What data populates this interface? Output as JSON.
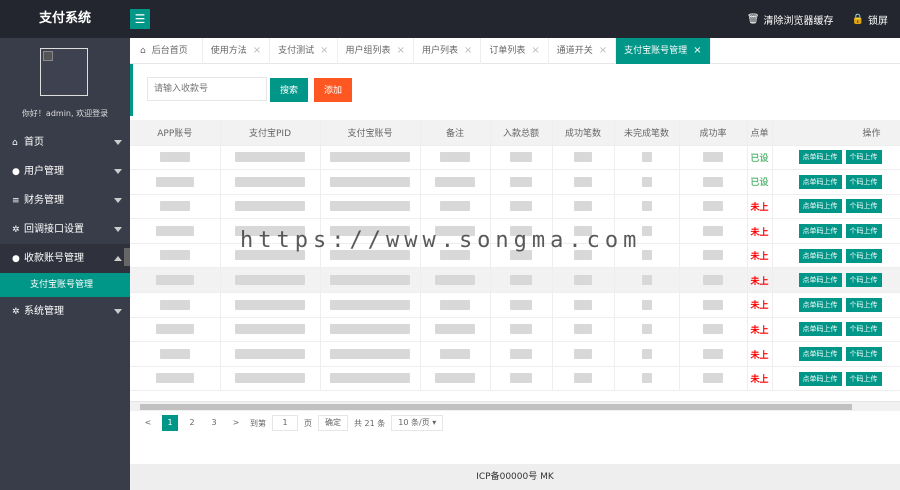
{
  "app": {
    "title": "支付系统"
  },
  "header": {
    "menu_icon": "hamburger-icon",
    "clear_cache": "清除浏览器缓存",
    "lock_screen": "锁屏"
  },
  "sidebar": {
    "greeting": "你好！admin, 欢迎登录",
    "items": [
      {
        "label": "首页",
        "icon": "home-icon"
      },
      {
        "label": "用户管理",
        "icon": "user-icon"
      },
      {
        "label": "财务管理",
        "icon": "list-icon"
      },
      {
        "label": "回调接口设置",
        "icon": "gear-icon"
      },
      {
        "label": "收款账号管理",
        "icon": "users-icon"
      },
      {
        "label": "系统管理",
        "icon": "gear-icon"
      }
    ],
    "active_sub": "支付宝账号管理"
  },
  "tabs": [
    {
      "label": "后台首页"
    },
    {
      "label": "使用方法"
    },
    {
      "label": "支付测试"
    },
    {
      "label": "用户组列表"
    },
    {
      "label": "用户列表"
    },
    {
      "label": "订单列表"
    },
    {
      "label": "通道开关"
    },
    {
      "label": "支付宝账号管理"
    }
  ],
  "search": {
    "placeholder": "请输入收款号",
    "search_label": "搜索",
    "add_label": "添加"
  },
  "table": {
    "columns": [
      "APP账号",
      "支付宝PID",
      "支付宝账号",
      "备注",
      "入款总额",
      "成功笔数",
      "未完成笔数",
      "成功率",
      "点单",
      "操作"
    ],
    "rows": [
      {
        "status": "已设"
      },
      {
        "status": "已设"
      },
      {
        "status": "未上"
      },
      {
        "status": "未上"
      },
      {
        "status": "未上"
      },
      {
        "status": "未上"
      },
      {
        "status": "未上"
      },
      {
        "status": "未上"
      },
      {
        "status": "未上"
      },
      {
        "status": "未上"
      }
    ],
    "action_upload_single": "点单码上传",
    "action_upload_fixed": "个码上传"
  },
  "pager": {
    "prev": "<",
    "pages": [
      "1",
      "2",
      "3"
    ],
    "next": ">",
    "goto": "到第",
    "goto_value": "1",
    "page_unit": "页",
    "confirm": "确定",
    "total": "共 21 条",
    "page_size": "10 条/页"
  },
  "footer": {
    "icp": "ICP备00000号 MK"
  },
  "watermark": "https://www.songma.com"
}
